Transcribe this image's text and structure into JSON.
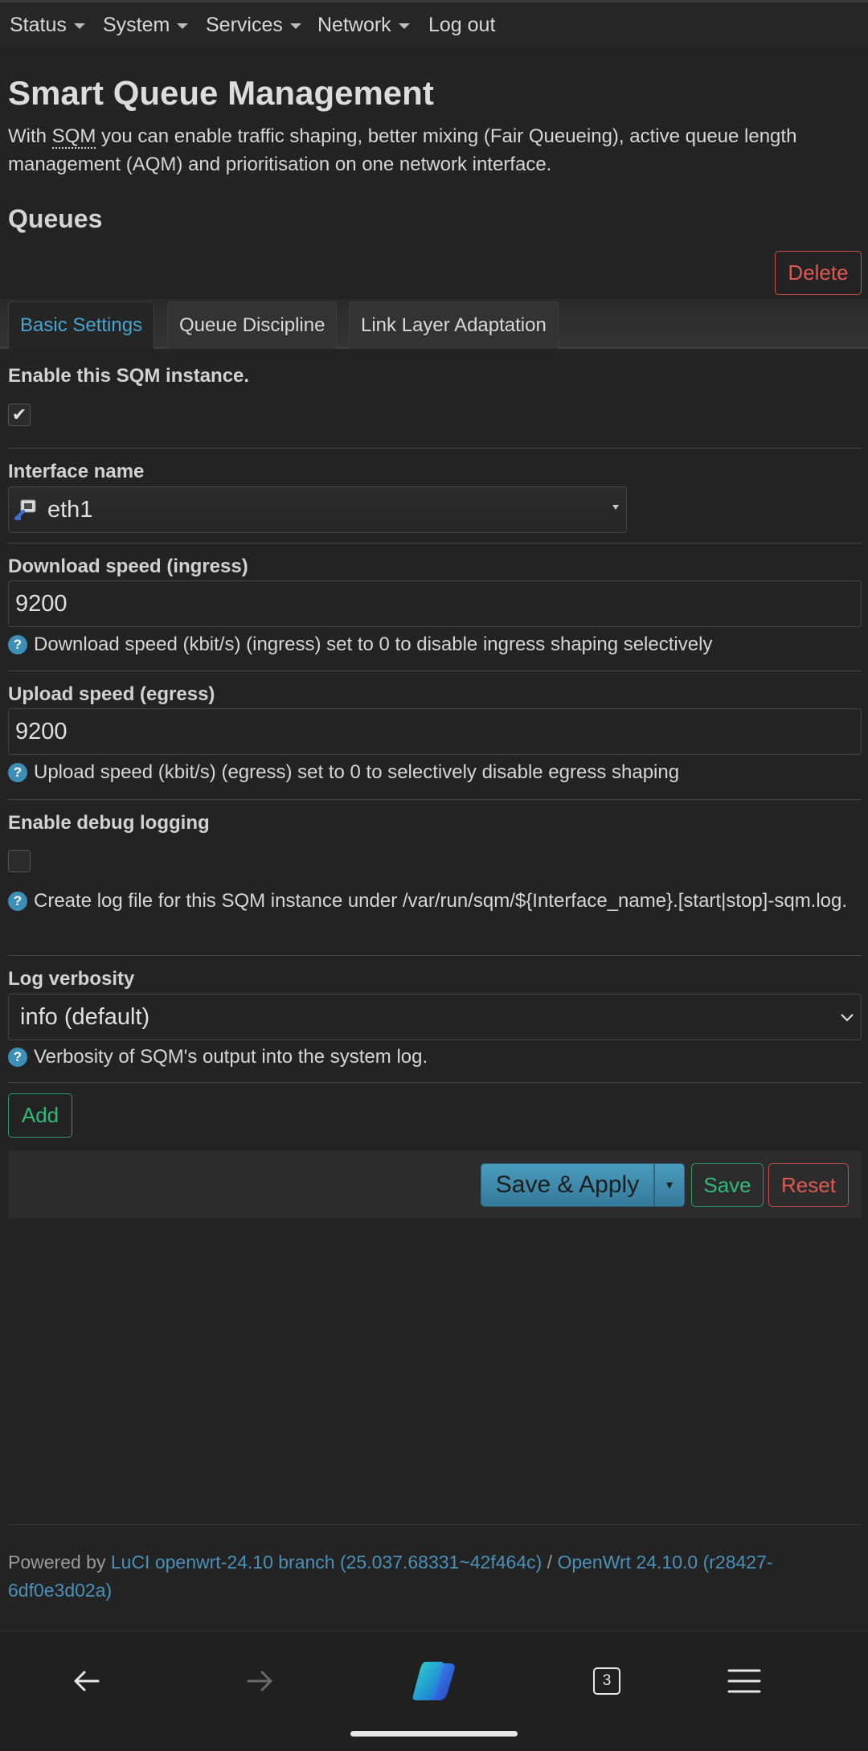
{
  "nav": {
    "items": [
      {
        "label": "Status",
        "has_caret": true
      },
      {
        "label": "System",
        "has_caret": true
      },
      {
        "label": "Services",
        "has_caret": true
      },
      {
        "label": "Network",
        "has_caret": true
      },
      {
        "label": "Log out",
        "has_caret": false
      }
    ]
  },
  "page": {
    "title": "Smart Queue Management",
    "desc_prefix": "With",
    "desc_abbr": "SQM",
    "desc_rest": "you can enable traffic shaping, better mixing (Fair Queueing), active queue length management (AQM) and prioritisation on one network interface.",
    "section_title": "Queues",
    "delete_label": "Delete"
  },
  "tabs": [
    {
      "label": "Basic Settings",
      "active": true
    },
    {
      "label": "Queue Discipline",
      "active": false
    },
    {
      "label": "Link Layer Adaptation",
      "active": false
    }
  ],
  "form": {
    "enable": {
      "label": "Enable this SQM instance.",
      "checked": true,
      "check_glyph": "✔"
    },
    "interface": {
      "label": "Interface name",
      "value": "eth1",
      "icon": "ethernet-port-icon"
    },
    "download": {
      "label": "Download speed (ingress)",
      "value": "9200",
      "help": "Download speed (kbit/s) (ingress) set to 0 to disable ingress shaping selectively"
    },
    "upload": {
      "label": "Upload speed (egress)",
      "value": "9200",
      "help": "Upload speed (kbit/s) (egress) set to 0 to selectively disable egress shaping"
    },
    "debug": {
      "label": "Enable debug logging",
      "checked": false,
      "help": "Create log file for this SQM instance under /var/run/sqm/${Interface_name}.[start|stop]-sqm.log."
    },
    "verbosity": {
      "label": "Log verbosity",
      "value": "info (default)",
      "help": "Verbosity of SQM's output into the system log."
    },
    "help_glyph": "?"
  },
  "actions": {
    "add": "Add",
    "save_apply": "Save & Apply",
    "save": "Save",
    "reset": "Reset",
    "dropdown_glyph": "▾"
  },
  "footer": {
    "prefix": "Powered by ",
    "luci_link": "LuCI openwrt-24.10 branch (25.037.68331~42f464c)",
    "sep": " / ",
    "openwrt_link": "OpenWrt 24.10.0 (r28427-6df0e3d02a)"
  },
  "browser": {
    "tab_count": "3",
    "icons": [
      "back-arrow-icon",
      "forward-arrow-icon",
      "copilot-icon",
      "tabs-icon",
      "menu-icon"
    ]
  },
  "colors": {
    "background": "#232323",
    "accent_blue": "#49a4cf",
    "danger_red": "#dd5a53",
    "success_green": "#34b87a",
    "primary_button": "#3a87a8"
  }
}
